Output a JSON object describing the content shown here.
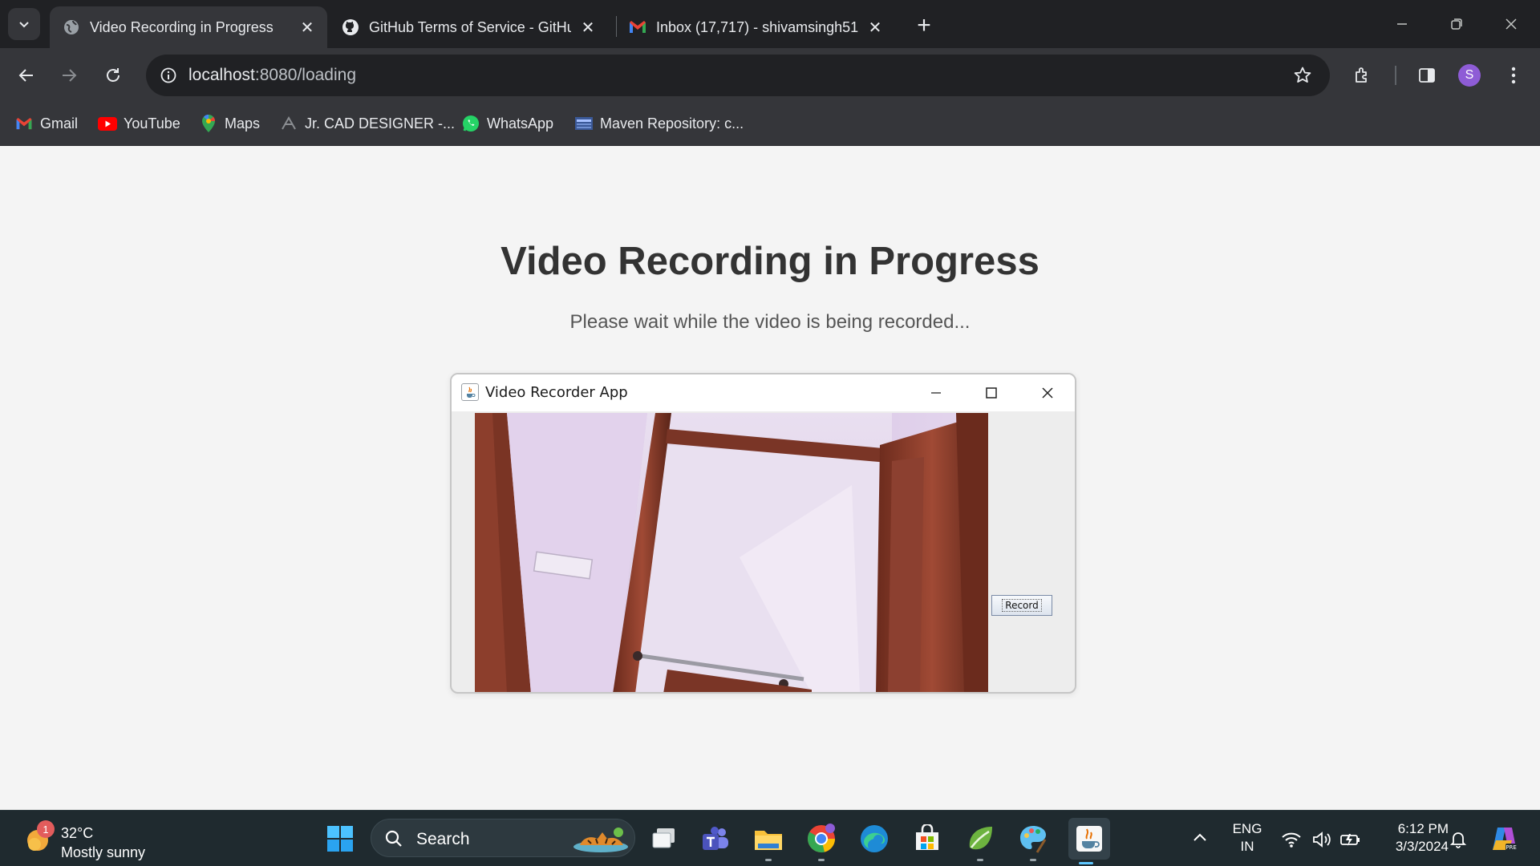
{
  "tabs": [
    {
      "title": "Video Recording in Progress",
      "favicon": "globe-icon",
      "active": true
    },
    {
      "title": "GitHub Terms of Service - GitHub",
      "favicon": "github-icon",
      "active": false
    },
    {
      "title": "Inbox (17,717) - shivamsingh51",
      "favicon": "gmail-icon",
      "active": false
    }
  ],
  "address_bar": {
    "host": "localhost",
    "path": ":8080/loading"
  },
  "profile": {
    "initial": "S",
    "color": "#8e5cd6"
  },
  "bookmarks": [
    {
      "label": "Gmail",
      "icon": "gmail-icon"
    },
    {
      "label": "YouTube",
      "icon": "youtube-icon"
    },
    {
      "label": "Maps",
      "icon": "maps-icon"
    },
    {
      "label": "Jr. CAD DESIGNER -...",
      "icon": "cad-icon"
    },
    {
      "label": "WhatsApp",
      "icon": "whatsapp-icon"
    },
    {
      "label": "Maven Repository: c...",
      "icon": "maven-icon"
    }
  ],
  "page": {
    "heading": "Video Recording in Progress",
    "subtext": "Please wait while the video is being recorded..."
  },
  "app_window": {
    "title": "Video Recorder App",
    "record_button": "Record"
  },
  "taskbar": {
    "weather": {
      "temp": "32°C",
      "desc": "Mostly sunny",
      "badge": "1"
    },
    "search_label": "Search",
    "pinned": [
      "windows-start-icon",
      "task-view-icon",
      "teams-icon",
      "file-explorer-icon",
      "chrome-icon",
      "edge-icon",
      "microsoft-store-icon",
      "spring-tools-icon",
      "paint-icon",
      "java-icon"
    ],
    "language": {
      "line1": "ENG",
      "line2": "IN"
    },
    "time": "6:12 PM",
    "date": "3/3/2024"
  },
  "colors": {
    "page_bg": "#f4f4f4",
    "heading": "#333333",
    "chrome_dark": "#202124",
    "chrome_mid": "#35363a",
    "taskbar": "#1f2a2f"
  }
}
